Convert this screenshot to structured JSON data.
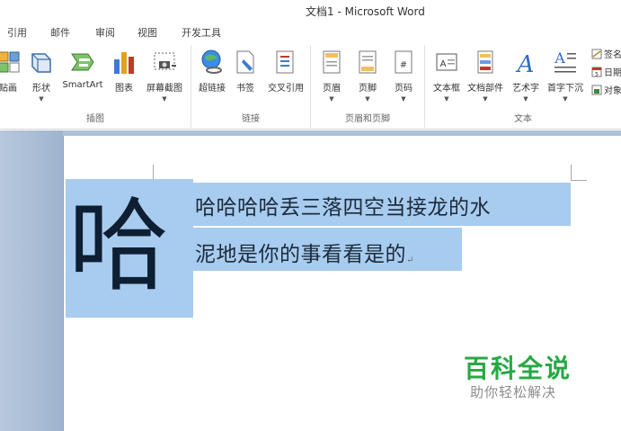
{
  "window": {
    "title": "文档1 - Microsoft Word"
  },
  "tabs": [
    "引用",
    "邮件",
    "审阅",
    "视图",
    "开发工具"
  ],
  "ribbon": {
    "groups": {
      "illustrations": {
        "label": "插图",
        "commands": [
          "剪贴画",
          "形状",
          "SmartArt",
          "图表",
          "屏幕截图"
        ]
      },
      "links": {
        "label": "链接",
        "commands": [
          "超链接",
          "书签",
          "交叉引用"
        ]
      },
      "header_footer": {
        "label": "页眉和页脚",
        "commands": [
          "页眉",
          "页脚",
          "页码"
        ]
      },
      "text": {
        "label": "文本",
        "commands": [
          "文本框",
          "文档部件",
          "艺术字",
          "首字下沉"
        ],
        "small_commands": [
          "签名",
          "日期",
          "对象"
        ]
      }
    }
  },
  "document": {
    "drop_cap": "哈",
    "line1": "哈哈哈哈丢三落四空当接龙的水",
    "line2": "泥地是你的事看看是的",
    "para_mark": "↵"
  },
  "watermark": {
    "title": "百科全说",
    "subtitle": "助你轻松解决"
  },
  "colors": {
    "selection": "#a8ccef",
    "watermark_green": "#27a844",
    "doc_background": "#aec1d8"
  }
}
